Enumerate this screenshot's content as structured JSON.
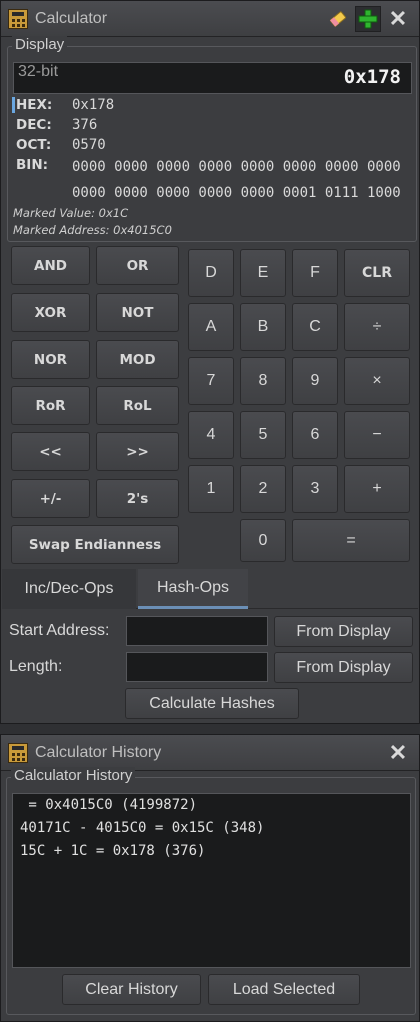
{
  "calculator": {
    "title": "Calculator",
    "display_group_label": "Display",
    "bit_mode": "32-bit",
    "display_value": "0x178",
    "readouts": [
      {
        "label": "HEX:",
        "value": "0x178"
      },
      {
        "label": "DEC:",
        "value": "376"
      },
      {
        "label": "OCT:",
        "value": "0570"
      },
      {
        "label": "BIN:",
        "value": "0000 0000 0000 0000 0000 0000 0000 0000"
      },
      {
        "label": "",
        "value": "0000 0000 0000 0000 0000 0001 0111 1000"
      }
    ],
    "marked_value": "Marked Value: 0x1C",
    "marked_address": "Marked Address: 0x4015C0",
    "op_buttons": [
      "AND",
      "OR",
      "XOR",
      "NOT",
      "NOR",
      "MOD",
      "RoR",
      "RoL",
      "<<",
      ">>",
      "+/-",
      "2's"
    ],
    "swap_button": "Swap Endianness",
    "keypad": [
      "D",
      "E",
      "F",
      "CLR",
      "A",
      "B",
      "C",
      "÷",
      "7",
      "8",
      "9",
      "×",
      "4",
      "5",
      "6",
      "−",
      "1",
      "2",
      "3",
      "+",
      "0",
      "="
    ],
    "tabs": [
      {
        "label": "Inc/Dec-Ops",
        "active": false
      },
      {
        "label": "Hash-Ops",
        "active": true
      }
    ],
    "start_address_label": "Start Address:",
    "start_address_value": "",
    "length_label": "Length:",
    "length_value": "",
    "from_display_label": "From Display",
    "calculate_hashes_label": "Calculate Hashes",
    "icons": [
      "calculator-app-icon",
      "eraser-icon",
      "add-icon",
      "close-icon"
    ],
    "colors": {
      "panel": "#3c3d40",
      "field": "#1a1b1c",
      "add_icon": "#2fb52f",
      "tab_indicator": "#6b8fb6"
    }
  },
  "history": {
    "title": "Calculator History",
    "group_label": "Calculator History",
    "lines": [
      " = 0x4015C0 (4199872)",
      "40171C - 4015C0 = 0x15C (348)",
      "15C + 1C = 0x178 (376)"
    ],
    "clear_label": "Clear History",
    "load_label": "Load Selected"
  }
}
